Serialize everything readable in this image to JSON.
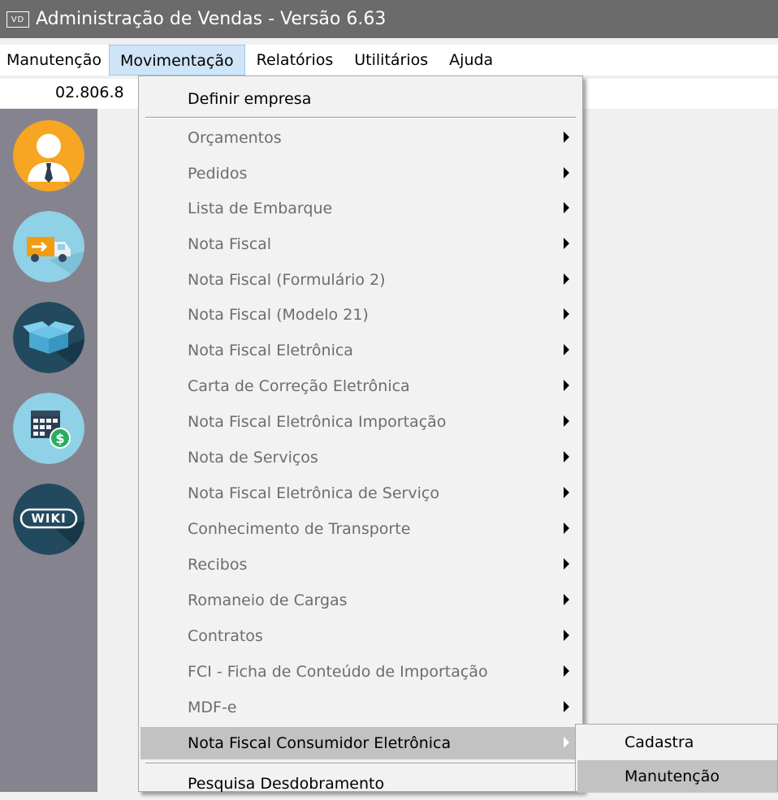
{
  "window": {
    "app_icon_text": "VD",
    "title": "Administração de Vendas - Versão 6.63"
  },
  "menubar": [
    {
      "label": "Manutenção"
    },
    {
      "label": "Movimentação"
    },
    {
      "label": "Relatórios"
    },
    {
      "label": "Utilitários"
    },
    {
      "label": "Ajuda"
    }
  ],
  "company_code": "02.806.8",
  "sidebar": {
    "buttons": [
      {
        "icon": "user-icon"
      },
      {
        "icon": "truck-icon"
      },
      {
        "icon": "box-icon"
      },
      {
        "icon": "calendar-money-icon"
      },
      {
        "icon": "wiki-icon",
        "text": "WIKI"
      }
    ]
  },
  "dropdown": {
    "definir": "Definir empresa",
    "items": [
      {
        "label": "Orçamentos"
      },
      {
        "label": "Pedidos"
      },
      {
        "label": "Lista de Embarque"
      },
      {
        "label": "Nota Fiscal"
      },
      {
        "label": "Nota Fiscal (Formulário 2)"
      },
      {
        "label": "Nota Fiscal (Modelo 21)"
      },
      {
        "label": "Nota Fiscal Eletrônica"
      },
      {
        "label": "Carta de Correção Eletrônica"
      },
      {
        "label": "Nota Fiscal Eletrônica Importação"
      },
      {
        "label": "Nota de Serviços"
      },
      {
        "label": "Nota Fiscal Eletrônica de Serviço"
      },
      {
        "label": "Conhecimento de Transporte"
      },
      {
        "label": "Recibos"
      },
      {
        "label": "Romaneio de Cargas"
      },
      {
        "label": "Contratos"
      },
      {
        "label": "FCI - Ficha de Conteúdo de Importação"
      },
      {
        "label": "MDF-e"
      }
    ],
    "nfce": "Nota Fiscal Consumidor Eletrônica",
    "pesquisa": "Pesquisa Desdobramento"
  },
  "submenu": {
    "items": [
      {
        "label": "Cadastra"
      },
      {
        "label": "Manutenção"
      }
    ]
  }
}
